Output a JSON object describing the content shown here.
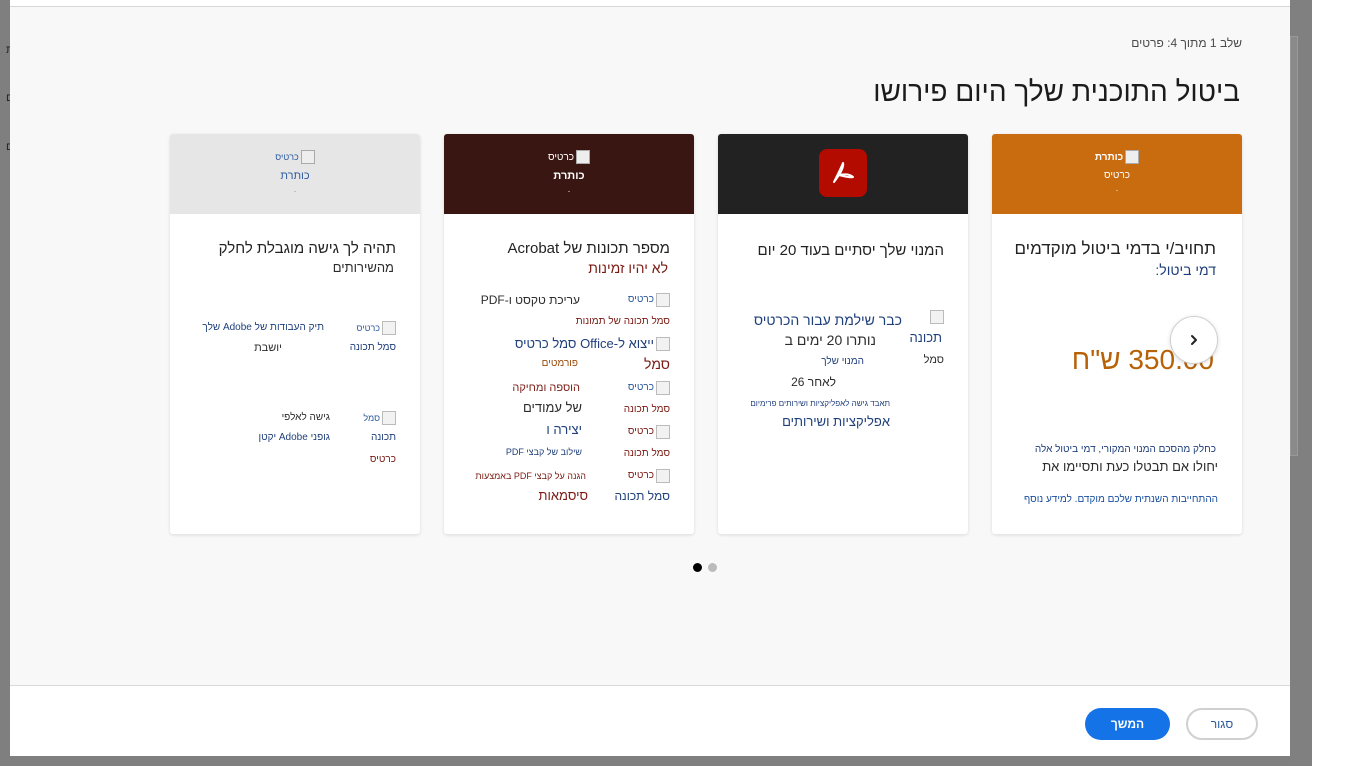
{
  "background": {
    "glyphs": [
      "ת",
      "ם",
      "ם",
      "ב"
    ]
  },
  "modal": {
    "step_label": "שלב 1 מתוך 4: פרטים",
    "title": "ביטול התוכנית שלך היום פירושו"
  },
  "cards": [
    {
      "header_color": "#c96b0f",
      "header_img_alt": "כותרת",
      "header_sub": "כרטיס",
      "header_dot": ".",
      "title": "תחויב/י בדמי ביטול מוקדמים",
      "subtitle": "דמי ביטול:",
      "price": "350.00 ש\"ח",
      "note_small": "כחלק מהסכם המנוי המקורי, דמי ביטול אלה",
      "note_main": "יחולו אם תבטלו כעת ותסיימו את",
      "link": "ההתחייבות השנתית שלכם מוקדם. למידע נוסף"
    },
    {
      "header_color": "#222222",
      "title": "המנוי שלך יסתיים בעוד 20 יום",
      "icon_alt_1": "תכונה",
      "icon_alt_2": "סמל",
      "line1": "כבר שילמת עבור הכרטיס",
      "line2": "נותרו 20 ימים ב",
      "line3": "המנוי שלך",
      "line4": "לאחר 26",
      "line5": "תאבד גישה לאפליקציות ושירותים פרימיום",
      "line6": "אפליקציות ושירותים"
    },
    {
      "header_color": "#3a1612",
      "header_img_alt": "כרטיס",
      "header_sub": "כותרת",
      "header_dot": ".",
      "title": "מספר תכונות של Acrobat",
      "subtitle": "לא יהיו זמינות",
      "features": [
        {
          "alt": "כרטיס",
          "text": "עריכת טקסט ו-PDF",
          "sub": "סמל תכונה של תמונות"
        },
        {
          "alt": "ייצוא ל-Office סמל כרטיס",
          "text": "סמל",
          "sub": "פורמטים"
        },
        {
          "alt": "כרטיס",
          "text": "הוספה ומחיקה",
          "sub": "סמל תכונה",
          "extra": "של עמודים"
        },
        {
          "alt": "כרטיס",
          "text": "יצירה ו",
          "sub": "סמל תכונה",
          "extra": "שילוב של קבצי PDF"
        },
        {
          "alt": "כרטיס",
          "text": "הגנה על קבצי PDF באמצעות",
          "sub": "סמל תכונה",
          "extra": "סיסמאות"
        }
      ]
    },
    {
      "header_color": "#e6e6e6",
      "header_img_alt": "כרטיס",
      "header_sub": "כותרת",
      "header_dot": ".",
      "title": "תהיה לך גישה מוגבלת לחלק",
      "subtitle": "מהשירותים",
      "features": [
        {
          "alt": "כרטיס",
          "alt2": "סמל תכונה",
          "text": "תיק העבודות של Adobe שלך",
          "sub": "יושבת"
        },
        {
          "alt": "סמל",
          "alt2": "תכונה",
          "alt3": "כרטיס",
          "text": "גישה לאלפי",
          "sub": "גופני Adobe יקטן"
        }
      ]
    }
  ],
  "pagination": {
    "active": 0,
    "count": 2,
    "active_color": "#000000",
    "inactive_color": "#bbbbbb"
  },
  "footer": {
    "continue_label": "המשך",
    "close_label": "סגור"
  },
  "icons": {
    "next": "chevron-right-icon",
    "pdf": "acrobat-logo-icon"
  }
}
